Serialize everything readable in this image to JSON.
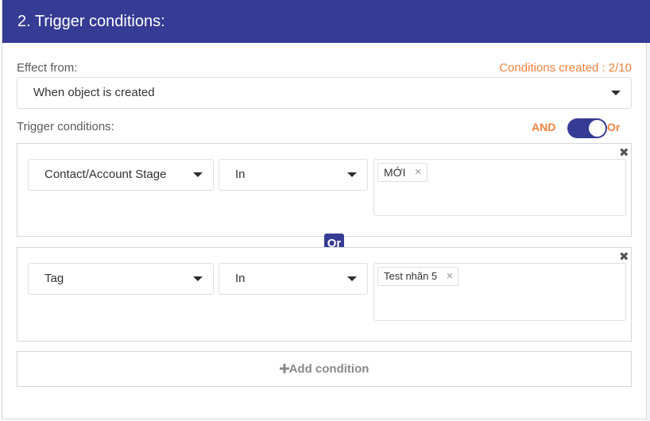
{
  "header": {
    "title": "2. Trigger conditions:"
  },
  "effect": {
    "label": "Effect from:",
    "counter": "Conditions created : 2/10",
    "selected": "When object is created"
  },
  "trigger": {
    "label": "Trigger conditions:",
    "and_label": "AND",
    "or_label": "Or",
    "toggle_state": "Or"
  },
  "conditions": [
    {
      "field": "Contact/Account Stage",
      "operator": "In",
      "tags": [
        "MỚI"
      ],
      "remove_symbol": "✖"
    },
    {
      "field": "Tag",
      "operator": "In",
      "tags": [
        "Test nhãn 5"
      ],
      "remove_symbol": "✖"
    }
  ],
  "joiner": "Or",
  "chip_remove_symbol": "×",
  "add_condition": {
    "icon": "plus-icon",
    "label": "Add condition"
  },
  "colors": {
    "header_bg": "#363c94",
    "accent_orange": "#f0823b",
    "toggle_bg": "#363c94"
  }
}
